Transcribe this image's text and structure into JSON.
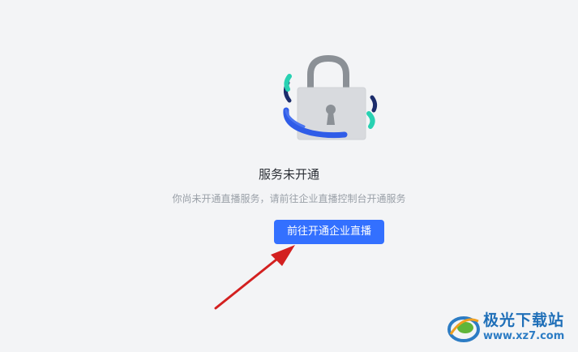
{
  "empty_state": {
    "title": "服务未开通",
    "description": "你尚未开通直播服务，请前往企业直播控制台开通服务",
    "button_label": "前往开通企业直播",
    "illustration": "lock-icon"
  },
  "annotation": {
    "arrow_color": "#d32020"
  },
  "watermark": {
    "name": "极光下载站",
    "url": "www.xz7.com"
  },
  "colors": {
    "accent": "#3370ff",
    "background": "#f3f4f6"
  }
}
